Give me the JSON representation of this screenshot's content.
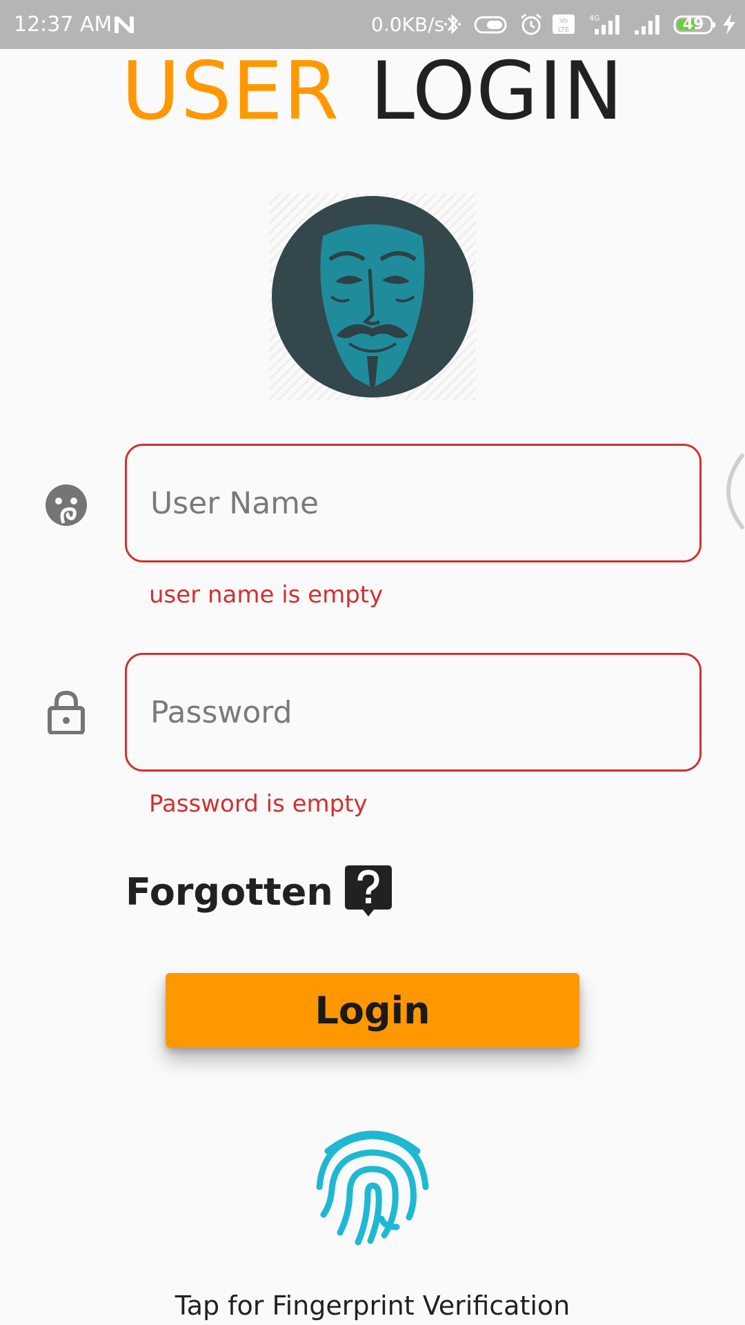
{
  "status_bar": {
    "time": "12:37 AM",
    "network_speed": "0.0KB/s",
    "battery_level": "49",
    "icons": [
      "n-notification-icon",
      "bluetooth-icon",
      "toggle-icon",
      "alarm-icon",
      "volte-icon",
      "signal-4g-icon",
      "signal-icon",
      "battery-icon",
      "charging-icon"
    ]
  },
  "header": {
    "title_part1": "USER",
    "title_part2": "LOGIN",
    "accent_color": "#ff9800"
  },
  "avatar": {
    "icon": "anonymous-mask-avatar"
  },
  "form": {
    "username": {
      "placeholder": "User Name",
      "value": "",
      "icon": "user-face-icon",
      "error": "user name is empty"
    },
    "password": {
      "placeholder": "Password",
      "value": "",
      "icon": "lock-icon",
      "error": "Password is empty"
    },
    "error_color": "#d32f2f"
  },
  "forgotten": {
    "label": "Forgotten",
    "icon": "help-bubble-icon"
  },
  "login_button": {
    "label": "Login",
    "color": "#ff9800"
  },
  "fingerprint": {
    "icon": "fingerprint-icon",
    "caption": "Tap for Fingerprint Verification",
    "color": "#1eb8d2"
  }
}
